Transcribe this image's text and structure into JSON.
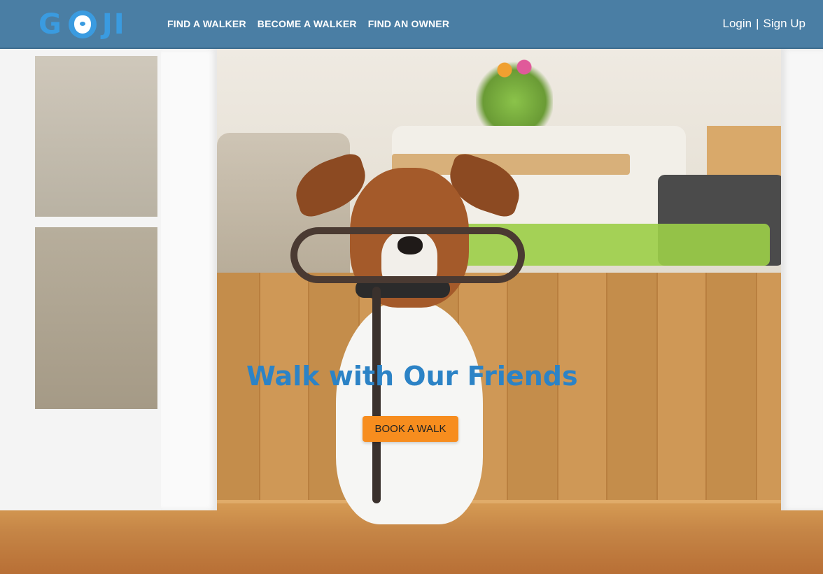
{
  "header": {
    "logo_text_left": "G",
    "logo_text_right": "JI",
    "nav": [
      {
        "label": "FIND A WALKER"
      },
      {
        "label": "BECOME A WALKER"
      },
      {
        "label": "FIND AN OWNER"
      }
    ],
    "auth": {
      "login": "Login",
      "separator": "|",
      "signup": "Sign Up"
    }
  },
  "hero": {
    "headline": "Walk with Our Friends",
    "cta_label": "BOOK A WALK"
  },
  "colors": {
    "header_bg": "#4a7ea4",
    "brand_blue": "#3a9be0",
    "headline": "#2c83c6",
    "cta_bg": "#f78d1e"
  },
  "icons": {
    "logo_mark": "dog-face-icon"
  }
}
